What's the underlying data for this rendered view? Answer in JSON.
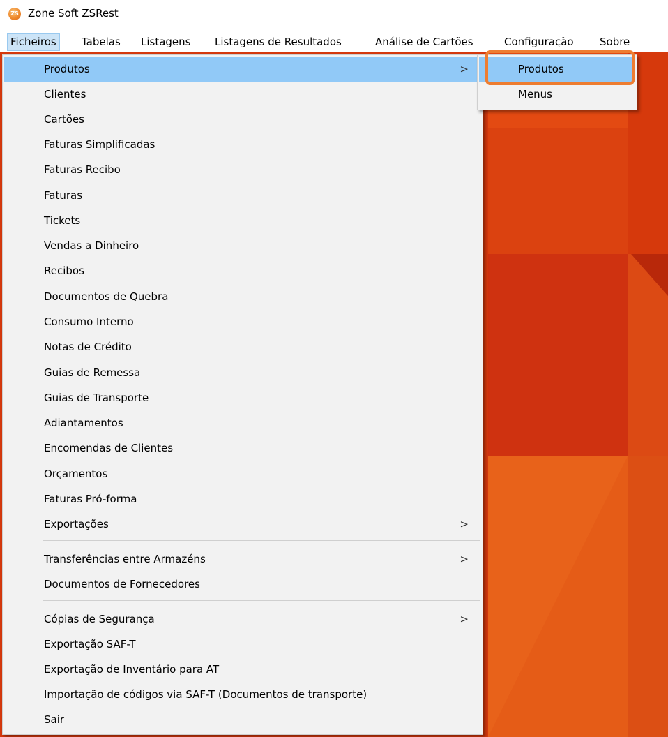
{
  "window": {
    "title": "Zone Soft ZSRest",
    "icon": "zonesoft-app-icon",
    "icon_text": "ZS"
  },
  "menubar": {
    "items": [
      {
        "label": "Ficheiros",
        "active": true
      },
      {
        "label": "Tabelas"
      },
      {
        "label": "Listagens"
      },
      {
        "label": "Listagens de Resultados"
      },
      {
        "label": "Análise de Cartões"
      },
      {
        "label": "Configuração"
      },
      {
        "label": "Sobre"
      }
    ]
  },
  "dropdown": {
    "items": [
      {
        "label": "Produtos",
        "submenu": true,
        "highlight": true
      },
      {
        "label": "Clientes"
      },
      {
        "label": "Cartões"
      },
      {
        "label": "Faturas Simplificadas"
      },
      {
        "label": "Faturas Recibo"
      },
      {
        "label": "Faturas"
      },
      {
        "label": "Tickets"
      },
      {
        "label": "Vendas a Dinheiro"
      },
      {
        "label": "Recibos"
      },
      {
        "label": "Documentos de Quebra"
      },
      {
        "label": "Consumo Interno"
      },
      {
        "label": "Notas de Crédito"
      },
      {
        "label": "Guias de Remessa"
      },
      {
        "label": "Guias de Transporte"
      },
      {
        "label": "Adiantamentos"
      },
      {
        "label": "Encomendas de Clientes"
      },
      {
        "label": "Orçamentos"
      },
      {
        "label": "Faturas Pró-forma"
      },
      {
        "label": "Exportações",
        "submenu": true
      },
      {
        "label": "Transferências entre Armazéns",
        "submenu": true
      },
      {
        "label": "Documentos de Fornecedores"
      },
      {
        "label": "Cópias de Segurança",
        "submenu": true
      },
      {
        "label": "Exportação SAF-T"
      },
      {
        "label": "Exportação de Inventário para AT"
      },
      {
        "label": "Importação de códigos via SAF-T (Documentos de transporte)"
      },
      {
        "label": "Sair"
      }
    ],
    "submenu_arrow": ">"
  },
  "submenu": {
    "items": [
      {
        "label": "Produtos",
        "highlight": true
      },
      {
        "label": "Menus"
      }
    ]
  },
  "colors": {
    "menu_highlight": "#91c9f7",
    "menubar_active": "#cce4f7",
    "callout_border": "#ee7d31",
    "background_orange": "#d4380d"
  }
}
